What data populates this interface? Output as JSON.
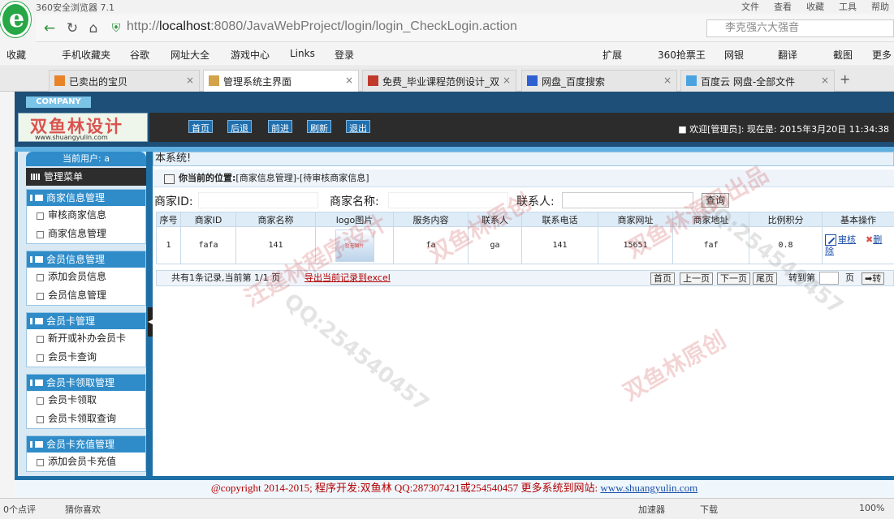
{
  "browser": {
    "title": "360安全浏览器 7.1",
    "menus": [
      "文件",
      "查看",
      "收藏",
      "工具",
      "帮助"
    ],
    "url_prefix": "http://",
    "url_host": "localhost",
    "url_rest": ":8080/JavaWebProject/login/login_CheckLogin.action",
    "search_text": "李克强六大强音",
    "bookmarks": [
      "收藏",
      "手机收藏夹",
      "谷歌",
      "网址大全",
      "游戏中心",
      "Links",
      "登录"
    ],
    "bookmarks_right": [
      "扩展",
      "360抢票王",
      "网银",
      "翻译",
      "截图",
      "更多"
    ],
    "tabs": [
      "已卖出的宝贝",
      "管理系统主界面",
      "免费_毕业课程范例设计_双",
      "网盘_百度搜索",
      "百度云 网盘-全部文件"
    ]
  },
  "header": {
    "company": "COMPANY",
    "brand": "双鱼林设计",
    "brand_site": "www.shuangyulin.com",
    "nav": [
      "首页",
      "后退",
      "前进",
      "刷新",
      "退出"
    ],
    "welcome": "■ 欢迎[管理员]:   现在是: 2015年3月20日 11:34:38"
  },
  "sidebar": {
    "current_user": "当前用户: a",
    "manage_menu": "管理菜单",
    "groups": [
      {
        "title": "商家信息管理",
        "items": [
          "审核商家信息",
          "商家信息管理"
        ]
      },
      {
        "title": "会员信息管理",
        "items": [
          "添加会员信息",
          "会员信息管理"
        ]
      },
      {
        "title": "会员卡管理",
        "items": [
          "新开或补办会员卡",
          "会员卡查询"
        ]
      },
      {
        "title": "会员卡领取管理",
        "items": [
          "会员卡领取",
          "会员卡领取查询"
        ]
      },
      {
        "title": "会员卡充值管理",
        "items": [
          "添加会员卡充值"
        ]
      }
    ]
  },
  "content": {
    "system_title": "本系统!",
    "location_label": "你当前的位置:",
    "location_path": "[商家信息管理]-[待审核商家信息]",
    "filters": {
      "shop_id": "商家ID:",
      "shop_name": "商家名称:",
      "contact": "联系人:",
      "query": "查询"
    },
    "columns": [
      "序号",
      "商家ID",
      "商家名称",
      "logo图片",
      "服务内容",
      "联系人",
      "联系电话",
      "商家网址",
      "商家地址",
      "比例积分",
      "基本操作"
    ],
    "rows": [
      {
        "no": "1",
        "id": "fafa",
        "name": "141",
        "logo": "暂无图片",
        "service": "fa",
        "contact": "ga",
        "phone": "141",
        "website": "15651",
        "address": "faf",
        "ratio": "0.8",
        "op_edit": "审核",
        "op_del": "删",
        "op_del_rest": "除"
      }
    ],
    "pager": {
      "info": "共有1条记录,当前第 1/1 页",
      "export": "导出当前记录到excel",
      "first": "首页",
      "prev": "上一页",
      "next": "下一页",
      "last": "尾页",
      "goto": "转到第",
      "page_unit": "页",
      "go": "转"
    }
  },
  "footer": {
    "text": "@copyright 2014-2015; 程序开发:双鱼林  QQ:287307421或254540457  更多系统到网站: ",
    "site": "www.shuangyulin.com"
  },
  "status": {
    "left": "0个点评",
    "fav": "猜你喜欢",
    "accel": "加速器",
    "download": "下载",
    "zoom": "100%"
  },
  "watermarks": [
    "双鱼林原创",
    "QQ:254540457",
    "汪建林程序设计",
    "双鱼林源码出品"
  ]
}
